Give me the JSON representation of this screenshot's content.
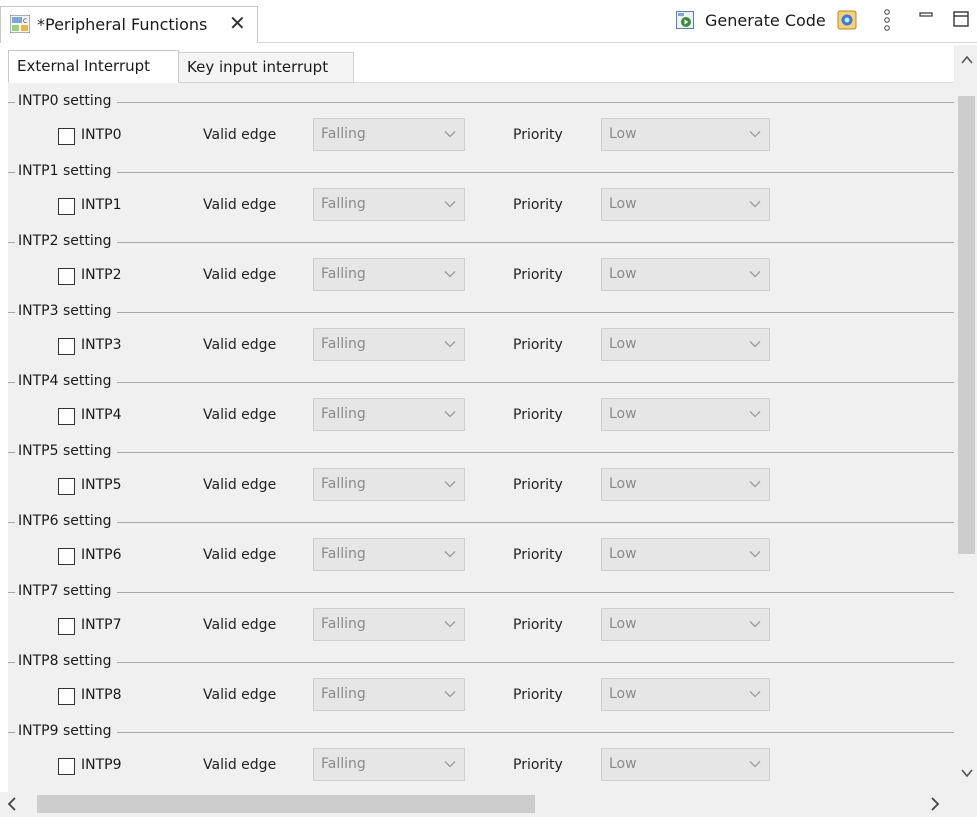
{
  "editor": {
    "tab_title": "*Peripheral Functions",
    "close_glyph": "✕",
    "generate_label": "Generate Code",
    "icons": [
      "code-generator-app-icon",
      "generate-code-icon",
      "tool-icon",
      "view-menu-icon",
      "minimize-icon",
      "maximize-icon"
    ]
  },
  "subtabs": [
    {
      "label": "External Interrupt",
      "active": true
    },
    {
      "label": "Key input interrupt",
      "active": false
    }
  ],
  "labels": {
    "valid_edge": "Valid edge",
    "priority": "Priority"
  },
  "groups": [
    {
      "title": "INTP0 setting",
      "checkbox_label": "INTP0",
      "checked": false,
      "edge": "Falling",
      "priority": "Low"
    },
    {
      "title": "INTP1 setting",
      "checkbox_label": "INTP1",
      "checked": false,
      "edge": "Falling",
      "priority": "Low"
    },
    {
      "title": "INTP2 setting",
      "checkbox_label": "INTP2",
      "checked": false,
      "edge": "Falling",
      "priority": "Low"
    },
    {
      "title": "INTP3 setting",
      "checkbox_label": "INTP3",
      "checked": false,
      "edge": "Falling",
      "priority": "Low"
    },
    {
      "title": "INTP4 setting",
      "checkbox_label": "INTP4",
      "checked": false,
      "edge": "Falling",
      "priority": "Low"
    },
    {
      "title": "INTP5 setting",
      "checkbox_label": "INTP5",
      "checked": false,
      "edge": "Falling",
      "priority": "Low"
    },
    {
      "title": "INTP6 setting",
      "checkbox_label": "INTP6",
      "checked": false,
      "edge": "Falling",
      "priority": "Low"
    },
    {
      "title": "INTP7 setting",
      "checkbox_label": "INTP7",
      "checked": false,
      "edge": "Falling",
      "priority": "Low"
    },
    {
      "title": "INTP8 setting",
      "checkbox_label": "INTP8",
      "checked": false,
      "edge": "Falling",
      "priority": "Low"
    },
    {
      "title": "INTP9 setting",
      "checkbox_label": "INTP9",
      "checked": false,
      "edge": "Falling",
      "priority": "Low"
    }
  ],
  "colors": {
    "panel_bg": "#f0f0f0",
    "disabled_select_bg": "#e6e6e6",
    "disabled_text": "#8a8a8a"
  }
}
